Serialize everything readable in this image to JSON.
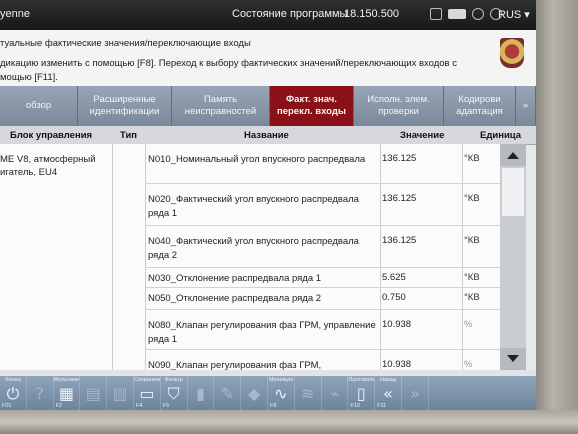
{
  "titlebar": {
    "model": "yenne",
    "state_label": "Состояние программы",
    "version": "18.150.500",
    "language": "RUS ▾"
  },
  "info": {
    "line1": "туальные фактические значения/переключающие входы",
    "line2": "дикацию изменить с помощью [F8]. Переход к выбору фактических значений/переключающих входов с",
    "line3": "мощью [F11]."
  },
  "tabs": [
    {
      "label": "обзор",
      "active": false
    },
    {
      "label": "Расширенные\nидентификации",
      "active": false
    },
    {
      "label": "Память\nнеисправностей",
      "active": false
    },
    {
      "label": "Факт. знач.\nперекл. входы",
      "active": true
    },
    {
      "label": "Исполн. элем.\nпроверки",
      "active": false
    },
    {
      "label": "Кодирови\nадаптация",
      "active": false
    },
    {
      "label": "»",
      "active": false
    }
  ],
  "table": {
    "headers": {
      "ecu": "Блок управления",
      "type": "Тип",
      "name": "Название",
      "value": "Значение",
      "unit": "Единица"
    },
    "ecu": "ME V8, атмосферный\nигатель, EU4",
    "rows": [
      {
        "name": "N010_Номинальный угол впускного распредвала",
        "value": "136.125",
        "unit": "°КВ",
        "faint": false
      },
      {
        "name": "N020_Фактический угол впускного распредвала ряда 1",
        "value": "136.125",
        "unit": "°КВ",
        "faint": false
      },
      {
        "name": "N040_Фактический угол впускного распредвала ряда 2",
        "value": "136.125",
        "unit": "°КВ",
        "faint": false
      },
      {
        "name": "N030_Отклонение распредвала ряда 1",
        "value": "5.625",
        "unit": "°КВ",
        "faint": false
      },
      {
        "name": "N050_Отклонение распредвала ряда 2",
        "value": "0.750",
        "unit": "°КВ",
        "faint": false
      },
      {
        "name": "N080_Клапан регулирования фаз ГРМ, управление ряда 1",
        "value": "10.938",
        "unit": "%",
        "faint": true
      },
      {
        "name": "N090_Клапан регулирования фаз ГРМ,",
        "value": "10.938",
        "unit": "%",
        "faint": true
      }
    ]
  },
  "fkeys": [
    {
      "label": "Конец",
      "num": "F01",
      "glyph": "⏻",
      "name": "exit",
      "dim": false
    },
    {
      "label": "",
      "num": "",
      "glyph": "?",
      "name": "help",
      "dim": true
    },
    {
      "label": "Мультиметр",
      "num": "F2",
      "glyph": "▦",
      "name": "multimeter",
      "dim": false
    },
    {
      "label": "",
      "num": "",
      "glyph": "▤",
      "name": "blank-a",
      "dim": true
    },
    {
      "label": "",
      "num": "",
      "glyph": "▥",
      "name": "blank-b",
      "dim": true
    },
    {
      "label": "Сохранение",
      "num": "F4",
      "glyph": "▭",
      "name": "save",
      "dim": false
    },
    {
      "label": "Фильтр",
      "num": "F5",
      "glyph": "⛉",
      "name": "filter",
      "dim": false
    },
    {
      "label": "",
      "num": "",
      "glyph": "▮",
      "name": "blank-c",
      "dim": true
    },
    {
      "label": "",
      "num": "",
      "glyph": "✎",
      "name": "blank-d",
      "dim": true
    },
    {
      "label": "",
      "num": "",
      "glyph": "◆",
      "name": "blank-e",
      "dim": true
    },
    {
      "label": "Минимум",
      "num": "F8",
      "glyph": "∿",
      "name": "minimum",
      "dim": false
    },
    {
      "label": "",
      "num": "",
      "glyph": "≋",
      "name": "blank-f",
      "dim": true
    },
    {
      "label": "",
      "num": "",
      "glyph": "⌁",
      "name": "blank-g",
      "dim": true
    },
    {
      "label": "Протоколы",
      "num": "F10",
      "glyph": "▯",
      "name": "protocols",
      "dim": false
    },
    {
      "label": "Назад",
      "num": "F11",
      "glyph": "«",
      "name": "back",
      "dim": false
    },
    {
      "label": "",
      "num": "",
      "glyph": "»",
      "name": "forward",
      "dim": true
    }
  ],
  "colors": {
    "active_tab": "#8b1119",
    "tab": "#8a98aa",
    "titlebar": "#1f2021",
    "fbar": "#7d93ad"
  }
}
